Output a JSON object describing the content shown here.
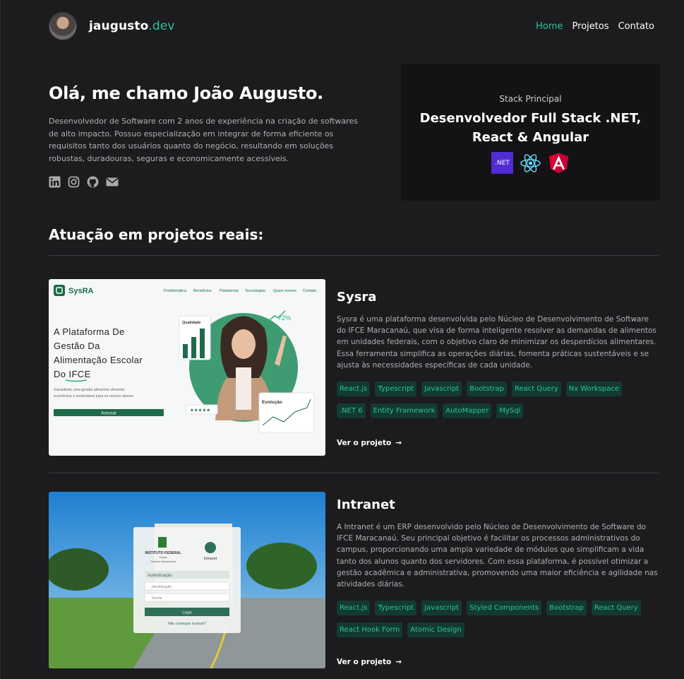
{
  "header": {
    "logo_main": "jaugusto",
    "logo_accent": ".dev",
    "nav": [
      "Home",
      "Projetos",
      "Contato"
    ]
  },
  "hero": {
    "title": "Olá, me chamo João Augusto.",
    "description": "Desenvolvedor de Software com 2 anos de experiência na criação de softwares de alto impacto. Possuo especialização em integrar de forma eficiente os requisitos tanto dos usuários quanto do negócio, resultando em soluções robustas, duradouras, seguras e economicamente acessíveis.",
    "socials": [
      "linkedin-icon",
      "instagram-icon",
      "github-icon",
      "email-icon"
    ]
  },
  "stack": {
    "label": "Stack Principal",
    "title_line1": "Desenvolvedor Full Stack .NET,",
    "title_line2": "React & Angular",
    "net_badge": ".NET"
  },
  "section_title": "Atuação em projetos reais:",
  "projects": [
    {
      "name": "Sysra",
      "description": "Sysra é uma plataforma desenvolvida pelo Núcleo de Desenvolvimento de Software do IFCE Maracanaú, que visa de forma inteligente resolver as demandas de alimentos em unidades federais, com o objetivo claro de minimizar os desperdícios alimentares. Essa ferramenta simplifica as operações diárias, fomenta práticas sustentáveis e se ajusta às necessidades específicas de cada unidade.",
      "tags": [
        "React.js",
        "Typescript",
        "Javascript",
        "Bootstrap",
        "React Query",
        "Nx Workspace",
        ".NET 6",
        "Entity Framework",
        "AutoMapper",
        "MySql"
      ],
      "link": "Ver o projeto",
      "preview": {
        "brand": "SysRA",
        "nav": [
          "Problemática",
          "Benefícios",
          "Plataforma",
          "Tecnologias",
          "Quem somos",
          "Contato"
        ],
        "headline_l1": "A Plataforma De",
        "headline_l2": "Gestão Da",
        "headline_l3": "Alimentação Escolar",
        "headline_l4": "Do IFCE",
        "sub": "Garantindo uma gestão alimentar eficiente, econômica e sustentável para os nossos alunos.",
        "button": "Acessar",
        "quality": "Qualidade",
        "percent": "72%",
        "evolution": "Evolução",
        "stars": "★★★★★"
      }
    },
    {
      "name": "Intranet",
      "description": "A Intranet é um ERP desenvolvido pelo Núcleo de Desenvolvimento de Software do IFCE Maracanaú. Seu principal objetivo é facilitar os processos administrativos do campus, proporcionando uma ampla variedade de módulos que simplificam a vida tanto dos alunos quanto dos servidores. Com essa plataforma, é possível otimizar a gestão acadêmica e administrativa, promovendo uma maior eficiência e agilidade nas atividades diárias.",
      "tags": [
        "React.js",
        "Typescript",
        "Javascript",
        "Styled Components",
        "Bootstrap",
        "React Query",
        "React Hook Form",
        "Atomic Design"
      ],
      "link": "Ver o projeto",
      "preview": {
        "inst": "INSTITUTO FEDERAL",
        "inst_sub": "Ceará",
        "inst_campus": "Campus Maracanaú",
        "app": "Intranet",
        "auth": "Autenticação",
        "user_ph": "Identificação",
        "pass_ph": "Senha",
        "login": "Login",
        "forgot": "Não consegue acessar?"
      }
    }
  ]
}
